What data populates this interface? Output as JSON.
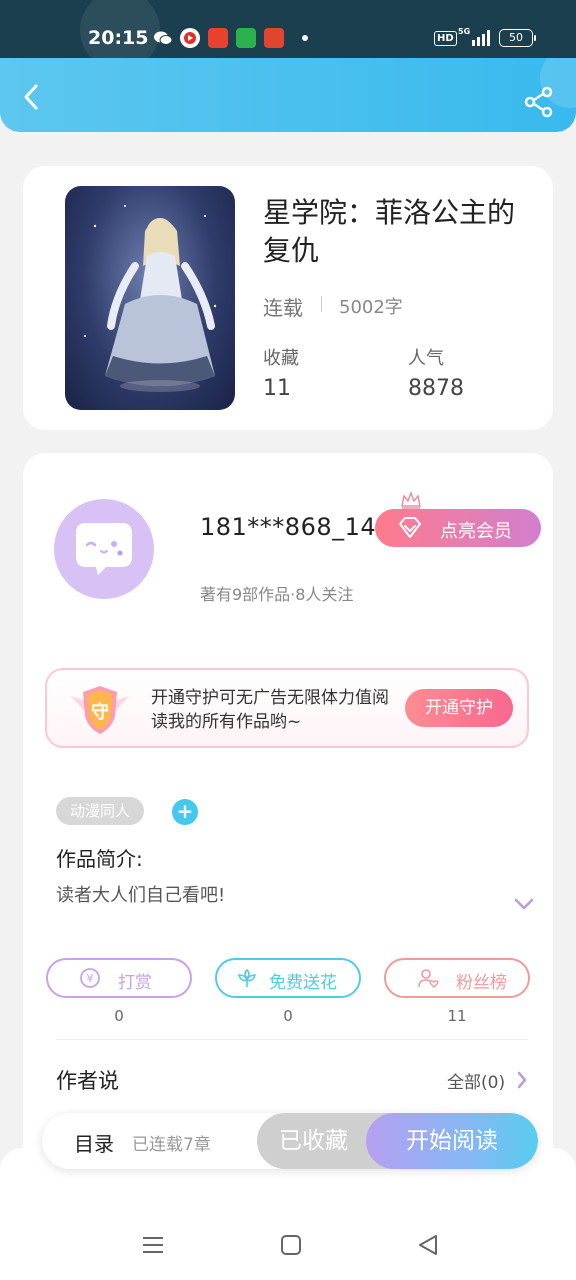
{
  "status_bar": {
    "time": "20:15",
    "apps": [
      "wechat-icon",
      "app-icon-red",
      "toutiao-icon",
      "app-icon-green",
      "app-icon-news"
    ],
    "network": "5G",
    "hd": "HD",
    "battery": "50"
  },
  "header": {
    "back_icon": "chevron-left-icon",
    "share_icon": "share-icon",
    "color": "#3fbbee"
  },
  "book": {
    "title": "星学院：菲洛公主的复仇",
    "status": "连载",
    "words": "5002字",
    "stats": [
      {
        "label": "收藏",
        "value": "11"
      },
      {
        "label": "人气",
        "value": "8878"
      }
    ]
  },
  "author": {
    "name": "181***868_14...",
    "meta": "著有9部作品·8人关注",
    "vip_label": "点亮会员"
  },
  "guard": {
    "badge_text": "守",
    "text": "开通守护可无广告无限体力值阅读我的所有作品哟~",
    "button": "开通守护"
  },
  "tags": {
    "tag": "动漫同人",
    "add": "+"
  },
  "intro": {
    "title": "作品简介:",
    "text": "读者大人们自己看吧!"
  },
  "actions": [
    {
      "label": "打赏",
      "count": "0",
      "color": "#c79be6"
    },
    {
      "label": "免费送花",
      "count": "0",
      "color": "#4fcbe8"
    },
    {
      "label": "粉丝榜",
      "count": "11",
      "color": "#f09a9a"
    }
  ],
  "author_says": {
    "title": "作者说",
    "all": "全部(0)"
  },
  "bottom_bar": {
    "toc": "目录",
    "toc_sub": "已连载7章",
    "collected": "已收藏",
    "read": "开始阅读"
  }
}
